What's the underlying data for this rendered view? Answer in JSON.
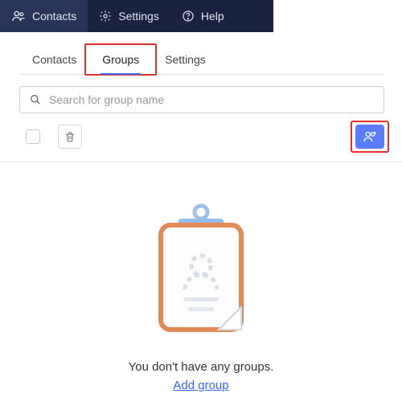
{
  "topnav": {
    "contacts": "Contacts",
    "settings": "Settings",
    "help": "Help"
  },
  "subtabs": {
    "contacts": "Contacts",
    "groups": "Groups",
    "settings": "Settings",
    "active": "groups"
  },
  "search": {
    "placeholder": "Search for group name"
  },
  "empty": {
    "message": "You don't have any groups.",
    "link": "Add group"
  },
  "colors": {
    "navbg": "#1b2240",
    "accent": "#5a7dff",
    "highlight": "#e03030",
    "link": "#3a66ff"
  }
}
